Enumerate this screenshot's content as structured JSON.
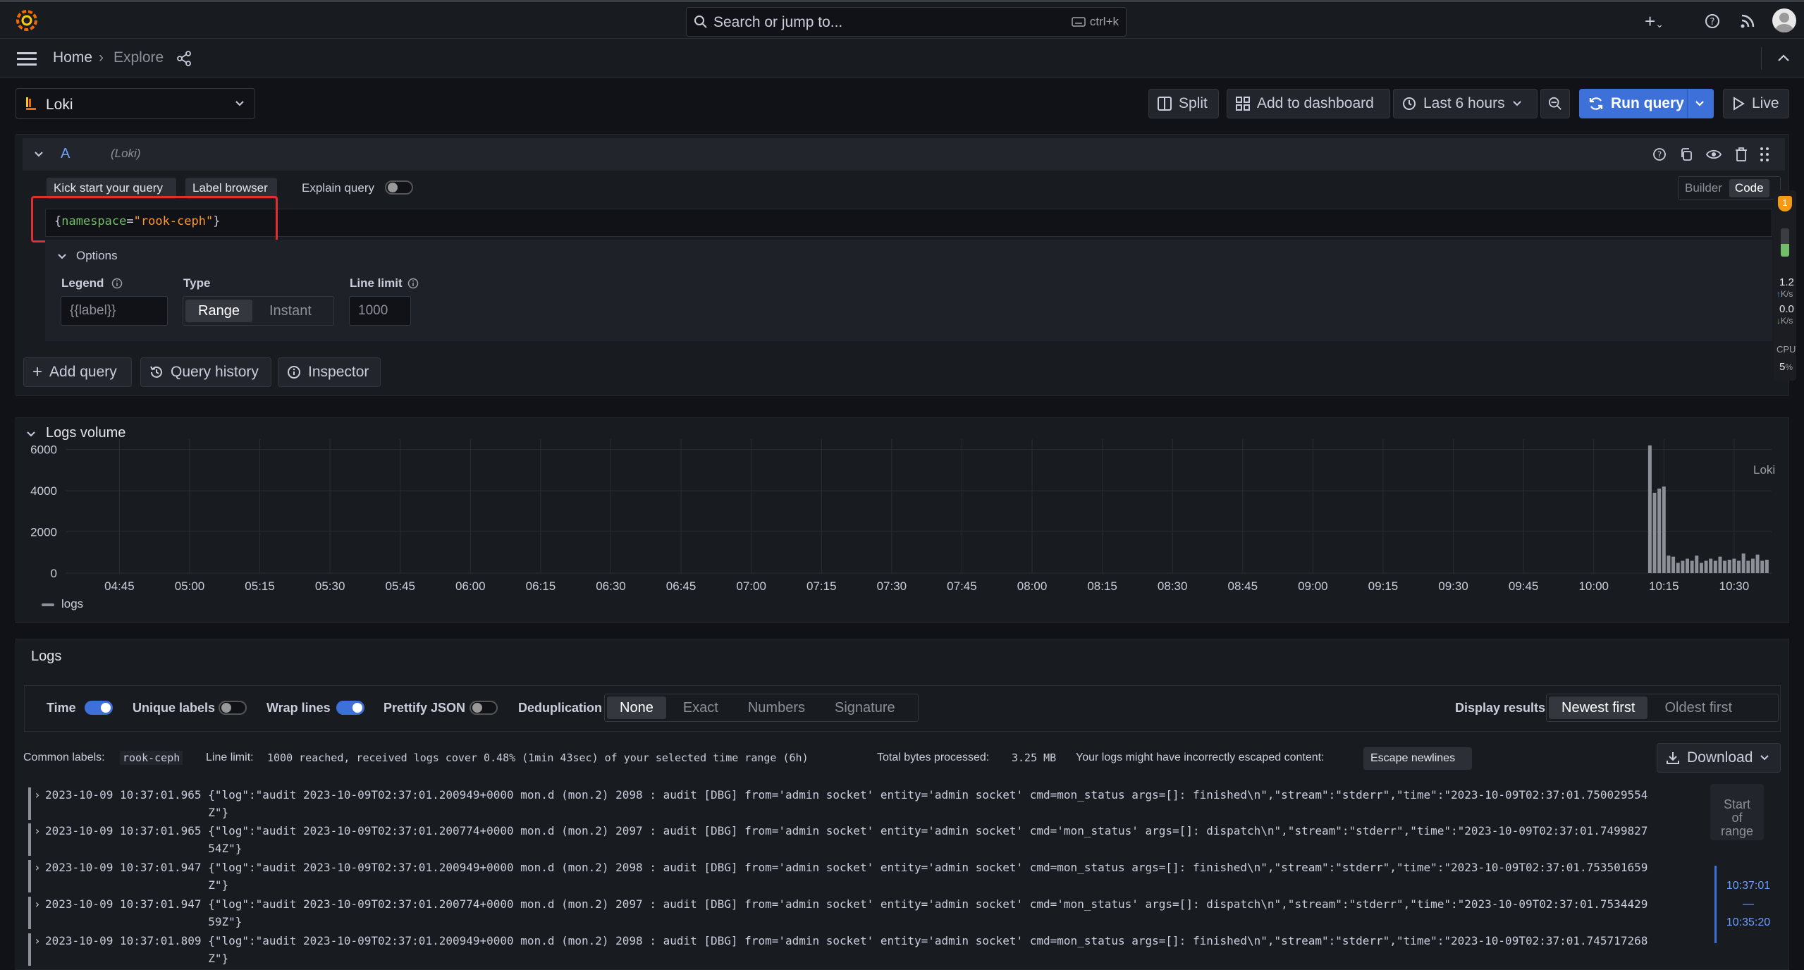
{
  "topbar": {
    "search_placeholder": "Search or jump to...",
    "search_shortcut": "ctrl+k"
  },
  "breadcrumb": {
    "home": "Home",
    "separator": "›",
    "current": "Explore"
  },
  "toolbar": {
    "datasource": "Loki",
    "split": "Split",
    "add_to_dashboard": "Add to dashboard",
    "time_range": "Last 6 hours",
    "run_query": "Run query",
    "live": "Live"
  },
  "query": {
    "ref_id": "A",
    "ds_label": "(Loki)",
    "kick_start": "Kick start your query",
    "label_browser": "Label browser",
    "explain_query": "Explain query",
    "builder": "Builder",
    "code": "Code",
    "expr_open": "{",
    "expr_key": "namespace",
    "expr_eq": "=",
    "expr_value": "\"rook-ceph\"",
    "expr_close": "}",
    "options_title": "Options",
    "legend_label": "Legend",
    "legend_placeholder": "{{label}}",
    "type_label": "Type",
    "type_range": "Range",
    "type_instant": "Instant",
    "line_limit_label": "Line limit",
    "line_limit_placeholder": "1000",
    "add_query": "Add query",
    "query_history": "Query history",
    "inspector": "Inspector"
  },
  "side_monitor": {
    "badge": "1",
    "up_value": "1.2",
    "up_unit": "K/s",
    "down_value": "0.0",
    "down_unit": "K/s",
    "cpu_label": "CPU",
    "cpu_value": "5",
    "cpu_unit": "%"
  },
  "logs_volume": {
    "title": "Logs volume",
    "source_label": "Loki",
    "legend": "logs"
  },
  "chart_data": {
    "type": "bar",
    "ylim": [
      0,
      6500
    ],
    "yticks": [
      "6000",
      "4000",
      "2000",
      "0"
    ],
    "xticks": [
      "04:45",
      "05:00",
      "05:15",
      "05:30",
      "05:45",
      "06:00",
      "06:15",
      "06:30",
      "06:45",
      "07:00",
      "07:15",
      "07:30",
      "07:45",
      "08:00",
      "08:15",
      "08:30",
      "08:45",
      "09:00",
      "09:15",
      "09:30",
      "09:45",
      "10:00",
      "10:15",
      "10:30"
    ],
    "series": [
      {
        "name": "logs",
        "color": "#8e9099",
        "x": [
          "10:12",
          "10:13",
          "10:14",
          "10:15",
          "10:16",
          "10:17",
          "10:18",
          "10:19",
          "10:20",
          "10:21",
          "10:22",
          "10:23",
          "10:24",
          "10:25",
          "10:26",
          "10:27",
          "10:28",
          "10:29",
          "10:30",
          "10:31",
          "10:32",
          "10:33",
          "10:34",
          "10:35",
          "10:36",
          "10:37"
        ],
        "values": [
          6200,
          3900,
          4100,
          4200,
          850,
          800,
          500,
          600,
          700,
          600,
          850,
          500,
          600,
          700,
          600,
          800,
          600,
          650,
          700,
          600,
          950,
          600,
          700,
          900,
          600,
          650
        ]
      }
    ]
  },
  "logs": {
    "title": "Logs",
    "time": "Time",
    "unique_labels": "Unique labels",
    "wrap_lines": "Wrap lines",
    "prettify_json": "Prettify JSON",
    "deduplication": "Deduplication",
    "dedup_options": [
      "None",
      "Exact",
      "Numbers",
      "Signature"
    ],
    "display_results": "Display results",
    "order_newest": "Newest first",
    "order_oldest": "Oldest first",
    "common_labels_label": "Common labels:",
    "common_labels_value": "rook-ceph",
    "line_limit_label": "Line limit:",
    "line_limit_value": "1000 reached, received logs cover 0.48% (1min 43sec) of your selected time range (6h)",
    "total_bytes_label": "Total bytes processed:",
    "total_bytes_value": "3.25 MB",
    "escape_warning": "Your logs might have incorrectly escaped content:",
    "escape_button": "Escape newlines",
    "download": "Download",
    "rows": [
      {
        "line1": "2023-10-09 10:37:01.965 {\"log\":\"audit 2023-10-09T02:37:01.200949+0000 mon.d (mon.2) 2098 : audit [DBG] from='admin socket' entity='admin socket' cmd=mon_status args=[]: finished\\n\",\"stream\":\"stderr\",\"time\":\"2023-10-09T02:37:01.750029554",
        "line2": "                        Z\"}"
      },
      {
        "line1": "2023-10-09 10:37:01.965 {\"log\":\"audit 2023-10-09T02:37:01.200774+0000 mon.d (mon.2) 2097 : audit [DBG] from='admin socket' entity='admin socket' cmd='mon_status' args=[]: dispatch\\n\",\"stream\":\"stderr\",\"time\":\"2023-10-09T02:37:01.7499827",
        "line2": "                        54Z\"}"
      },
      {
        "line1": "2023-10-09 10:37:01.947 {\"log\":\"audit 2023-10-09T02:37:01.200949+0000 mon.d (mon.2) 2098 : audit [DBG] from='admin socket' entity='admin socket' cmd=mon_status args=[]: finished\\n\",\"stream\":\"stderr\",\"time\":\"2023-10-09T02:37:01.753501659",
        "line2": "                        Z\"}"
      },
      {
        "line1": "2023-10-09 10:37:01.947 {\"log\":\"audit 2023-10-09T02:37:01.200774+0000 mon.d (mon.2) 2097 : audit [DBG] from='admin socket' entity='admin socket' cmd='mon_status' args=[]: dispatch\\n\",\"stream\":\"stderr\",\"time\":\"2023-10-09T02:37:01.7534429",
        "line2": "                        59Z\"}"
      },
      {
        "line1": "2023-10-09 10:37:01.809 {\"log\":\"audit 2023-10-09T02:37:01.200949+0000 mon.d (mon.2) 2098 : audit [DBG] from='admin socket' entity='admin socket' cmd=mon_status args=[]: finished\\n\",\"stream\":\"stderr\",\"time\":\"2023-10-09T02:37:01.745717268",
        "line2": "                        Z\"}"
      }
    ],
    "range_start_line1": "Start",
    "range_start_line2": "of",
    "range_start_line3": "range",
    "range_top": "10:37:01",
    "range_sep": "—",
    "range_bottom": "10:35:20"
  },
  "colors": {
    "accent": "#3d71d9",
    "highlight": "#e02f2f",
    "grafana_orange": "#f46800"
  }
}
